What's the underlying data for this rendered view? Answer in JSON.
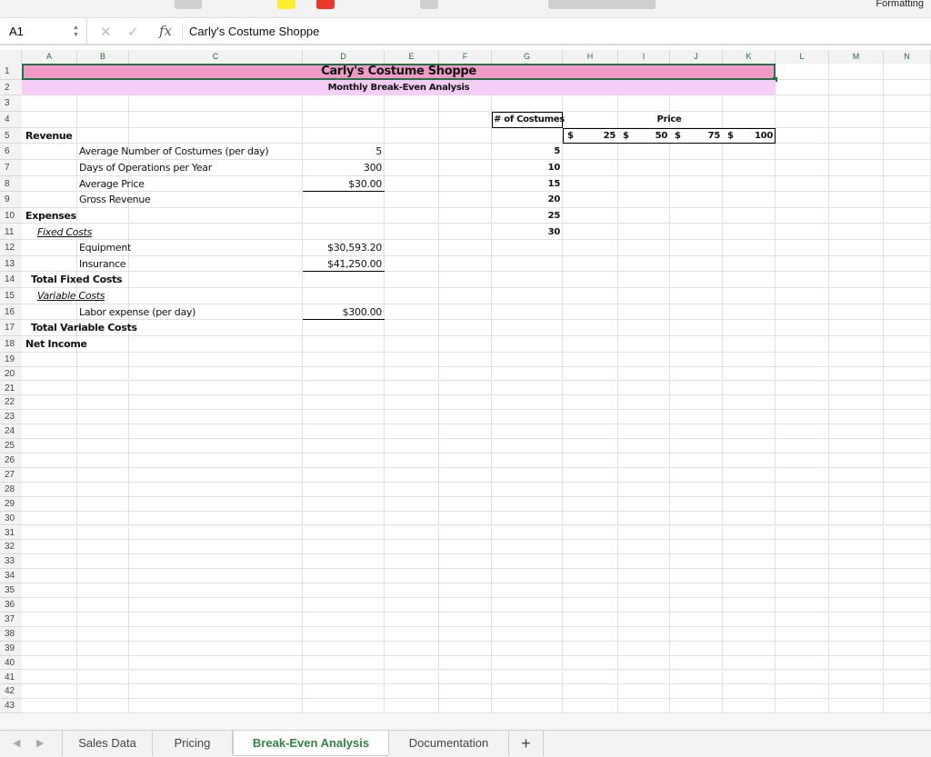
{
  "ribbon": {
    "formatting_label": "Formatting",
    "highlight_color": "#ffee33",
    "font_color": "#e8392b"
  },
  "formula_bar": {
    "name_box": "A1",
    "cancel_icon": "✕",
    "enter_icon": "✓",
    "fx_label": "fx",
    "value": "Carly's Costume Shoppe"
  },
  "columns": [
    "A",
    "B",
    "C",
    "D",
    "E",
    "F",
    "G",
    "H",
    "I",
    "J",
    "K",
    "L",
    "M",
    "N"
  ],
  "rows": [
    "1",
    "2",
    "3",
    "4",
    "5",
    "6",
    "7",
    "8",
    "9",
    "10",
    "11",
    "12",
    "13",
    "14",
    "15",
    "16",
    "17",
    "18",
    "19",
    "20",
    "21",
    "22",
    "23",
    "24",
    "25",
    "26",
    "27",
    "28",
    "29",
    "30",
    "31",
    "32",
    "33",
    "34",
    "35",
    "36",
    "37",
    "38",
    "39",
    "40",
    "41",
    "42",
    "43"
  ],
  "colors": {
    "title_fill": "#f19ac8",
    "subtitle_fill": "#f6cdf6",
    "header_text": "#2b6b3a",
    "active_tab": "#2e8540"
  },
  "cells": {
    "title": "Carly's Costume Shoppe",
    "subtitle": "Monthly Break-Even Analysis",
    "revenue": "Revenue",
    "avg_costumes_label": "Average Number of Costumes (per day)",
    "avg_costumes_value": "5",
    "days_label": "Days of Operations per Year",
    "days_value": "300",
    "avg_price_label": "Average Price",
    "avg_price_value": "$30.00",
    "gross_revenue_label": "Gross Revenue",
    "expenses": "Expenses",
    "fixed_costs": "Fixed Costs",
    "equipment_label": "Equipment",
    "equipment_value": "$30,593.20",
    "insurance_label": "Insurance",
    "insurance_value": "$41,250.00",
    "total_fixed": "Total Fixed Costs",
    "variable_costs": "Variable Costs",
    "labor_label": "Labor expense (per day)",
    "labor_value": "$300.00",
    "total_variable": "Total Variable Costs",
    "net_income": "Net Income",
    "num_costumes_header": "# of Costumes",
    "price_header": "Price",
    "currency": "$",
    "prices": [
      "25",
      "50",
      "75",
      "100"
    ],
    "costume_counts": [
      "5",
      "10",
      "15",
      "20",
      "25",
      "30"
    ]
  },
  "tabs": [
    {
      "label": "Sales Data"
    },
    {
      "label": "Pricing"
    },
    {
      "label": "Break-Even Analysis",
      "active": true
    },
    {
      "label": "Documentation"
    }
  ],
  "add_sheet": "+"
}
